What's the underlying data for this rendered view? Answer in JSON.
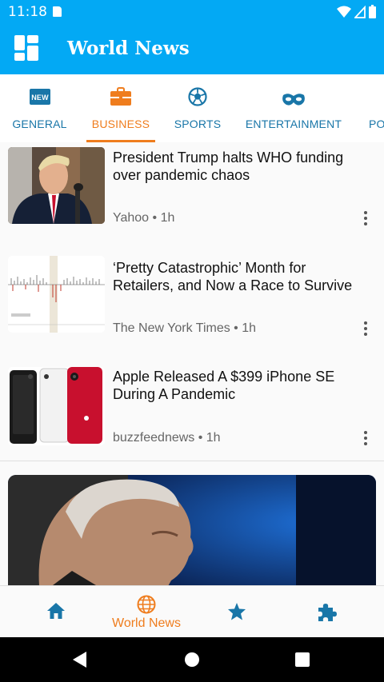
{
  "status_bar": {
    "time": "11:18"
  },
  "app_bar": {
    "title": "World News",
    "menu_icon": "dashboard-icon"
  },
  "tabs": [
    {
      "label": "GENERAL",
      "icon": "new-badge-icon",
      "active": false,
      "badge_text": "NEW"
    },
    {
      "label": "BUSINESS",
      "icon": "briefcase-icon",
      "active": true
    },
    {
      "label": "SPORTS",
      "icon": "soccer-ball-icon",
      "active": false
    },
    {
      "label": "ENTERTAINMENT",
      "icon": "mask-icon",
      "active": false
    },
    {
      "label": "PO",
      "icon": "",
      "active": false
    }
  ],
  "articles": [
    {
      "headline": "President Trump halts WHO funding over pandemic chaos",
      "meta": "Yahoo • 1h"
    },
    {
      "headline": "‘Pretty Catastrophic’ Month for Retailers, and Now a Race to Survive",
      "meta": "The New York Times • 1h"
    },
    {
      "headline": "Apple Released A $399 iPhone SE During A Pandemic",
      "meta": "buzzfeednews • 1h"
    }
  ],
  "bottom_nav": [
    {
      "label": "",
      "icon": "home-icon",
      "active": false
    },
    {
      "label": "World News",
      "icon": "globe-icon",
      "active": true
    },
    {
      "label": "",
      "icon": "star-icon",
      "active": false
    },
    {
      "label": "",
      "icon": "puzzle-icon",
      "active": false
    }
  ],
  "colors": {
    "primary": "#03a9f4",
    "accent": "#ef7d1e",
    "tab_text": "#1976a8"
  }
}
